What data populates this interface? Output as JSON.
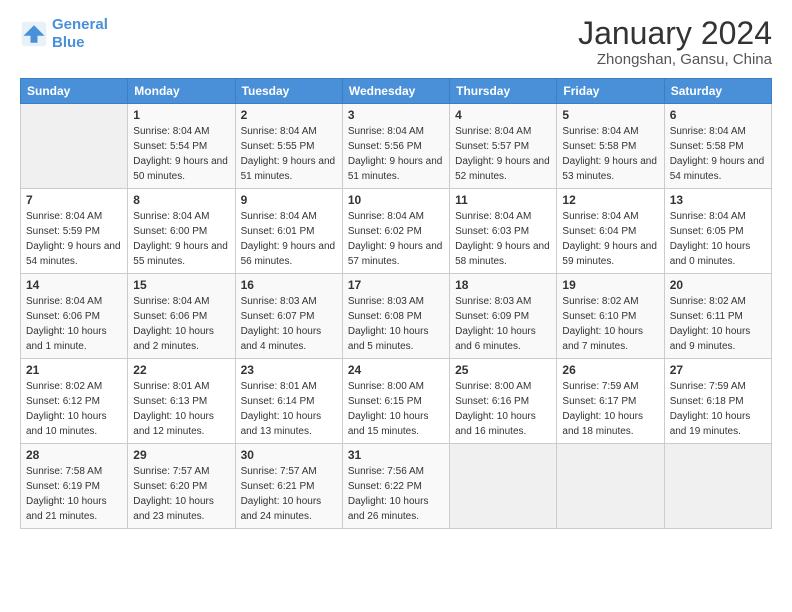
{
  "header": {
    "logo_line1": "General",
    "logo_line2": "Blue",
    "title": "January 2024",
    "subtitle": "Zhongshan, Gansu, China"
  },
  "days_of_week": [
    "Sunday",
    "Monday",
    "Tuesday",
    "Wednesday",
    "Thursday",
    "Friday",
    "Saturday"
  ],
  "weeks": [
    [
      {
        "day": "",
        "sunrise": "",
        "sunset": "",
        "daylight": ""
      },
      {
        "day": "1",
        "sunrise": "Sunrise: 8:04 AM",
        "sunset": "Sunset: 5:54 PM",
        "daylight": "Daylight: 9 hours and 50 minutes."
      },
      {
        "day": "2",
        "sunrise": "Sunrise: 8:04 AM",
        "sunset": "Sunset: 5:55 PM",
        "daylight": "Daylight: 9 hours and 51 minutes."
      },
      {
        "day": "3",
        "sunrise": "Sunrise: 8:04 AM",
        "sunset": "Sunset: 5:56 PM",
        "daylight": "Daylight: 9 hours and 51 minutes."
      },
      {
        "day": "4",
        "sunrise": "Sunrise: 8:04 AM",
        "sunset": "Sunset: 5:57 PM",
        "daylight": "Daylight: 9 hours and 52 minutes."
      },
      {
        "day": "5",
        "sunrise": "Sunrise: 8:04 AM",
        "sunset": "Sunset: 5:58 PM",
        "daylight": "Daylight: 9 hours and 53 minutes."
      },
      {
        "day": "6",
        "sunrise": "Sunrise: 8:04 AM",
        "sunset": "Sunset: 5:58 PM",
        "daylight": "Daylight: 9 hours and 54 minutes."
      }
    ],
    [
      {
        "day": "7",
        "sunrise": "Sunrise: 8:04 AM",
        "sunset": "Sunset: 5:59 PM",
        "daylight": "Daylight: 9 hours and 54 minutes."
      },
      {
        "day": "8",
        "sunrise": "Sunrise: 8:04 AM",
        "sunset": "Sunset: 6:00 PM",
        "daylight": "Daylight: 9 hours and 55 minutes."
      },
      {
        "day": "9",
        "sunrise": "Sunrise: 8:04 AM",
        "sunset": "Sunset: 6:01 PM",
        "daylight": "Daylight: 9 hours and 56 minutes."
      },
      {
        "day": "10",
        "sunrise": "Sunrise: 8:04 AM",
        "sunset": "Sunset: 6:02 PM",
        "daylight": "Daylight: 9 hours and 57 minutes."
      },
      {
        "day": "11",
        "sunrise": "Sunrise: 8:04 AM",
        "sunset": "Sunset: 6:03 PM",
        "daylight": "Daylight: 9 hours and 58 minutes."
      },
      {
        "day": "12",
        "sunrise": "Sunrise: 8:04 AM",
        "sunset": "Sunset: 6:04 PM",
        "daylight": "Daylight: 9 hours and 59 minutes."
      },
      {
        "day": "13",
        "sunrise": "Sunrise: 8:04 AM",
        "sunset": "Sunset: 6:05 PM",
        "daylight": "Daylight: 10 hours and 0 minutes."
      }
    ],
    [
      {
        "day": "14",
        "sunrise": "Sunrise: 8:04 AM",
        "sunset": "Sunset: 6:06 PM",
        "daylight": "Daylight: 10 hours and 1 minute."
      },
      {
        "day": "15",
        "sunrise": "Sunrise: 8:04 AM",
        "sunset": "Sunset: 6:06 PM",
        "daylight": "Daylight: 10 hours and 2 minutes."
      },
      {
        "day": "16",
        "sunrise": "Sunrise: 8:03 AM",
        "sunset": "Sunset: 6:07 PM",
        "daylight": "Daylight: 10 hours and 4 minutes."
      },
      {
        "day": "17",
        "sunrise": "Sunrise: 8:03 AM",
        "sunset": "Sunset: 6:08 PM",
        "daylight": "Daylight: 10 hours and 5 minutes."
      },
      {
        "day": "18",
        "sunrise": "Sunrise: 8:03 AM",
        "sunset": "Sunset: 6:09 PM",
        "daylight": "Daylight: 10 hours and 6 minutes."
      },
      {
        "day": "19",
        "sunrise": "Sunrise: 8:02 AM",
        "sunset": "Sunset: 6:10 PM",
        "daylight": "Daylight: 10 hours and 7 minutes."
      },
      {
        "day": "20",
        "sunrise": "Sunrise: 8:02 AM",
        "sunset": "Sunset: 6:11 PM",
        "daylight": "Daylight: 10 hours and 9 minutes."
      }
    ],
    [
      {
        "day": "21",
        "sunrise": "Sunrise: 8:02 AM",
        "sunset": "Sunset: 6:12 PM",
        "daylight": "Daylight: 10 hours and 10 minutes."
      },
      {
        "day": "22",
        "sunrise": "Sunrise: 8:01 AM",
        "sunset": "Sunset: 6:13 PM",
        "daylight": "Daylight: 10 hours and 12 minutes."
      },
      {
        "day": "23",
        "sunrise": "Sunrise: 8:01 AM",
        "sunset": "Sunset: 6:14 PM",
        "daylight": "Daylight: 10 hours and 13 minutes."
      },
      {
        "day": "24",
        "sunrise": "Sunrise: 8:00 AM",
        "sunset": "Sunset: 6:15 PM",
        "daylight": "Daylight: 10 hours and 15 minutes."
      },
      {
        "day": "25",
        "sunrise": "Sunrise: 8:00 AM",
        "sunset": "Sunset: 6:16 PM",
        "daylight": "Daylight: 10 hours and 16 minutes."
      },
      {
        "day": "26",
        "sunrise": "Sunrise: 7:59 AM",
        "sunset": "Sunset: 6:17 PM",
        "daylight": "Daylight: 10 hours and 18 minutes."
      },
      {
        "day": "27",
        "sunrise": "Sunrise: 7:59 AM",
        "sunset": "Sunset: 6:18 PM",
        "daylight": "Daylight: 10 hours and 19 minutes."
      }
    ],
    [
      {
        "day": "28",
        "sunrise": "Sunrise: 7:58 AM",
        "sunset": "Sunset: 6:19 PM",
        "daylight": "Daylight: 10 hours and 21 minutes."
      },
      {
        "day": "29",
        "sunrise": "Sunrise: 7:57 AM",
        "sunset": "Sunset: 6:20 PM",
        "daylight": "Daylight: 10 hours and 23 minutes."
      },
      {
        "day": "30",
        "sunrise": "Sunrise: 7:57 AM",
        "sunset": "Sunset: 6:21 PM",
        "daylight": "Daylight: 10 hours and 24 minutes."
      },
      {
        "day": "31",
        "sunrise": "Sunrise: 7:56 AM",
        "sunset": "Sunset: 6:22 PM",
        "daylight": "Daylight: 10 hours and 26 minutes."
      },
      {
        "day": "",
        "sunrise": "",
        "sunset": "",
        "daylight": ""
      },
      {
        "day": "",
        "sunrise": "",
        "sunset": "",
        "daylight": ""
      },
      {
        "day": "",
        "sunrise": "",
        "sunset": "",
        "daylight": ""
      }
    ]
  ]
}
